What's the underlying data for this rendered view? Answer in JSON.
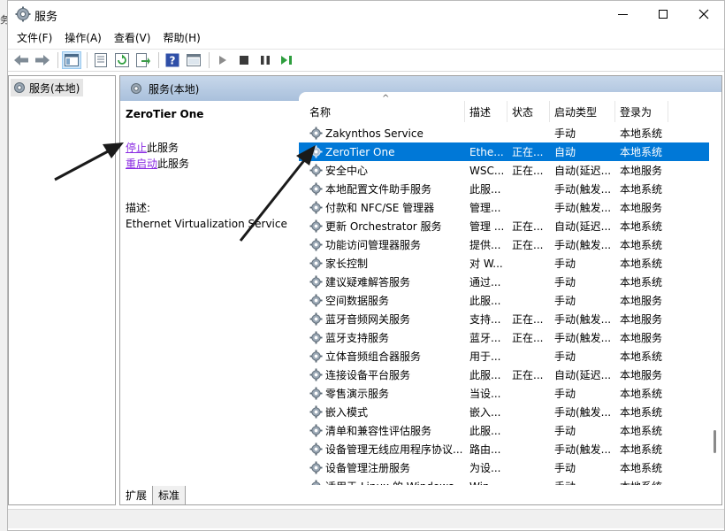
{
  "window": {
    "title": "服务",
    "edge_glyph": "务"
  },
  "menu": [
    "文件(F)",
    "操作(A)",
    "查看(V)",
    "帮助(H)"
  ],
  "toolbar_icons": [
    "back-icon",
    "forward-icon",
    "show-hide-console-tree-icon",
    "properties-icon",
    "refresh-icon",
    "export-list-icon",
    "help-icon",
    "mmc-view-icon",
    "start-service-icon",
    "stop-service-icon",
    "pause-service-icon",
    "restart-service-icon"
  ],
  "tree": {
    "root_label": "服务(本地)"
  },
  "pane_header": {
    "title": "服务(本地)"
  },
  "detail": {
    "service_name": "ZeroTier One",
    "stop_link": "停止",
    "stop_suffix": "此服务",
    "restart_link": "重启动",
    "restart_suffix": "此服务",
    "desc_label": "描述:",
    "desc_text": "Ethernet Virtualization Service"
  },
  "columns": {
    "name": "名称",
    "desc": "描述",
    "status": "状态",
    "type": "启动类型",
    "logon": "登录为"
  },
  "services": [
    {
      "name": "Zakynthos Service",
      "desc": "",
      "status": "",
      "type": "手动",
      "logon": "本地系统"
    },
    {
      "name": "ZeroTier One",
      "desc": "Ethe...",
      "status": "正在...",
      "type": "自动",
      "logon": "本地系统",
      "selected": true
    },
    {
      "name": "安全中心",
      "desc": "WSC...",
      "status": "正在...",
      "type": "自动(延迟...",
      "logon": "本地服务"
    },
    {
      "name": "本地配置文件助手服务",
      "desc": "此服...",
      "status": "",
      "type": "手动(触发...",
      "logon": "本地系统"
    },
    {
      "name": "付款和 NFC/SE 管理器",
      "desc": "管理...",
      "status": "",
      "type": "手动(触发...",
      "logon": "本地服务"
    },
    {
      "name": "更新 Orchestrator 服务",
      "desc": "管理 ...",
      "status": "正在...",
      "type": "自动(延迟...",
      "logon": "本地系统"
    },
    {
      "name": "功能访问管理器服务",
      "desc": "提供...",
      "status": "正在...",
      "type": "手动(触发...",
      "logon": "本地系统"
    },
    {
      "name": "家长控制",
      "desc": "对 W...",
      "status": "",
      "type": "手动",
      "logon": "本地系统"
    },
    {
      "name": "建议疑难解答服务",
      "desc": "通过...",
      "status": "",
      "type": "手动",
      "logon": "本地系统"
    },
    {
      "name": "空间数据服务",
      "desc": "此服...",
      "status": "",
      "type": "手动",
      "logon": "本地服务"
    },
    {
      "name": "蓝牙音频网关服务",
      "desc": "支持...",
      "status": "正在...",
      "type": "手动(触发...",
      "logon": "本地服务"
    },
    {
      "name": "蓝牙支持服务",
      "desc": "蓝牙...",
      "status": "正在...",
      "type": "手动(触发...",
      "logon": "本地服务"
    },
    {
      "name": "立体音频组合器服务",
      "desc": "用于...",
      "status": "",
      "type": "手动",
      "logon": "本地系统"
    },
    {
      "name": "连接设备平台服务",
      "desc": "此服...",
      "status": "正在...",
      "type": "自动(延迟...",
      "logon": "本地服务"
    },
    {
      "name": "零售演示服务",
      "desc": "当设...",
      "status": "",
      "type": "手动",
      "logon": "本地系统"
    },
    {
      "name": "嵌入模式",
      "desc": "嵌入...",
      "status": "",
      "type": "手动(触发...",
      "logon": "本地系统"
    },
    {
      "name": "清单和兼容性评估服务",
      "desc": "此服...",
      "status": "",
      "type": "手动",
      "logon": "本地系统"
    },
    {
      "name": "设备管理无线应用程序协议...",
      "desc": "路由...",
      "status": "",
      "type": "手动(触发...",
      "logon": "本地系统"
    },
    {
      "name": "设备管理注册服务",
      "desc": "为设...",
      "status": "",
      "type": "手动",
      "logon": "本地系统"
    },
    {
      "name": "适用于 Linux 的 Windows ...",
      "desc": "Win...",
      "status": "",
      "type": "手动",
      "logon": "本地系统"
    }
  ],
  "tabs": [
    "扩展",
    "标准"
  ],
  "colors": {
    "selection": "#0078d7",
    "pane_header": "#b9cce4",
    "link": "#8a2be2"
  }
}
